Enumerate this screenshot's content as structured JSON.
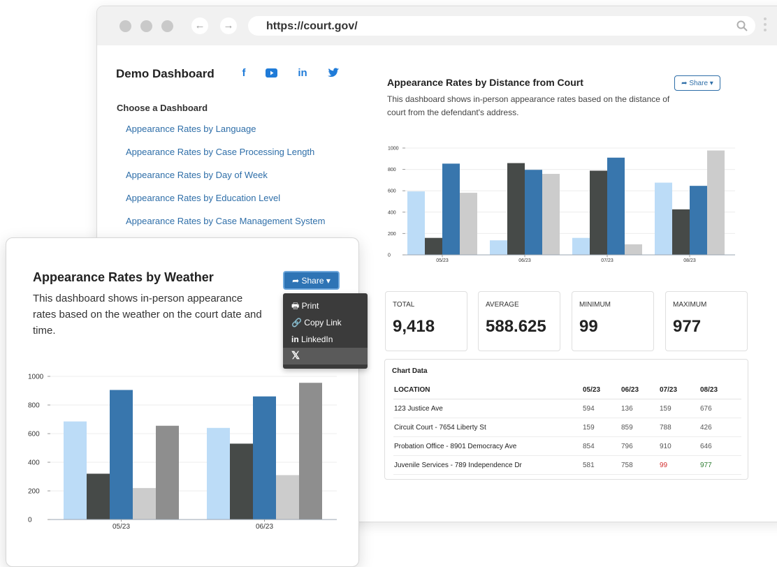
{
  "browser": {
    "url": "https://court.gov/"
  },
  "sidebar": {
    "title": "Demo Dashboard",
    "social": [
      "f",
      "in"
    ],
    "choose_label": "Choose a Dashboard",
    "items": [
      "Appearance Rates by Language",
      "Appearance Rates by Case Processing Length",
      "Appearance Rates by Day of Week",
      "Appearance Rates by Education Level",
      "Appearance Rates by Case Management System"
    ]
  },
  "distance": {
    "title": "Appearance Rates by Distance from Court",
    "description": "This dashboard shows in-person appearance rates based on the distance of court from the defendant's address.",
    "share_label": "Share"
  },
  "stats": [
    {
      "label": "TOTAL",
      "value": "9,418"
    },
    {
      "label": "AVERAGE",
      "value": "588.625"
    },
    {
      "label": "MINIMUM",
      "value": "99"
    },
    {
      "label": "MAXIMUM",
      "value": "977"
    }
  ],
  "table": {
    "title": "Chart Data",
    "headers": [
      "LOCATION",
      "05/23",
      "06/23",
      "07/23",
      "08/23"
    ],
    "rows": [
      [
        "123 Justice Ave",
        "594",
        "136",
        "159",
        "676"
      ],
      [
        "Circuit Court - 7654 Liberty St",
        "159",
        "859",
        "788",
        "426"
      ],
      [
        "Probation Office - 8901 Democracy Ave",
        "854",
        "796",
        "910",
        "646"
      ],
      [
        "Juvenile Services - 789 Independence Dr",
        "581",
        "758",
        "99",
        "977"
      ]
    ]
  },
  "weather": {
    "title": "Appearance Rates by Weather",
    "description": "This dashboard shows in-person appearance rates based on the weather on the court date and time.",
    "share_label": "Share",
    "menu": {
      "print": "Print",
      "copy": "Copy Link",
      "linkedin": "LinkedIn",
      "x": "𝕏"
    }
  },
  "colors": {
    "light_blue": "#bcdcf7",
    "dark_gray": "#464a48",
    "blue": "#3876ad",
    "light_gray": "#cccccc",
    "mid_gray": "#8e8e8e",
    "link": "#2e6ea8",
    "min_red": "#d32f2f",
    "max_green": "#2e7d32"
  },
  "chart_data": [
    {
      "type": "bar",
      "categories": [
        "05/23",
        "06/23",
        "07/23",
        "08/23"
      ],
      "ylim": [
        0,
        1000
      ],
      "yticks": [
        0,
        200,
        400,
        600,
        800,
        1000
      ],
      "grid": true,
      "series": [
        {
          "values": [
            594,
            136,
            159,
            676
          ]
        },
        {
          "values": [
            159,
            859,
            788,
            426
          ]
        },
        {
          "values": [
            854,
            796,
            910,
            646
          ]
        },
        {
          "values": [
            581,
            758,
            99,
            977
          ]
        }
      ]
    },
    {
      "type": "bar",
      "categories": [
        "05/23",
        "06/23"
      ],
      "ylim": [
        0,
        1000
      ],
      "yticks": [
        0,
        200,
        400,
        600,
        800,
        1000
      ],
      "grid": true,
      "series": [
        {
          "values": [
            685,
            640
          ]
        },
        {
          "values": [
            320,
            530
          ]
        },
        {
          "values": [
            905,
            860
          ]
        },
        {
          "values": [
            220,
            310
          ]
        },
        {
          "values": [
            655,
            955
          ]
        }
      ]
    }
  ]
}
